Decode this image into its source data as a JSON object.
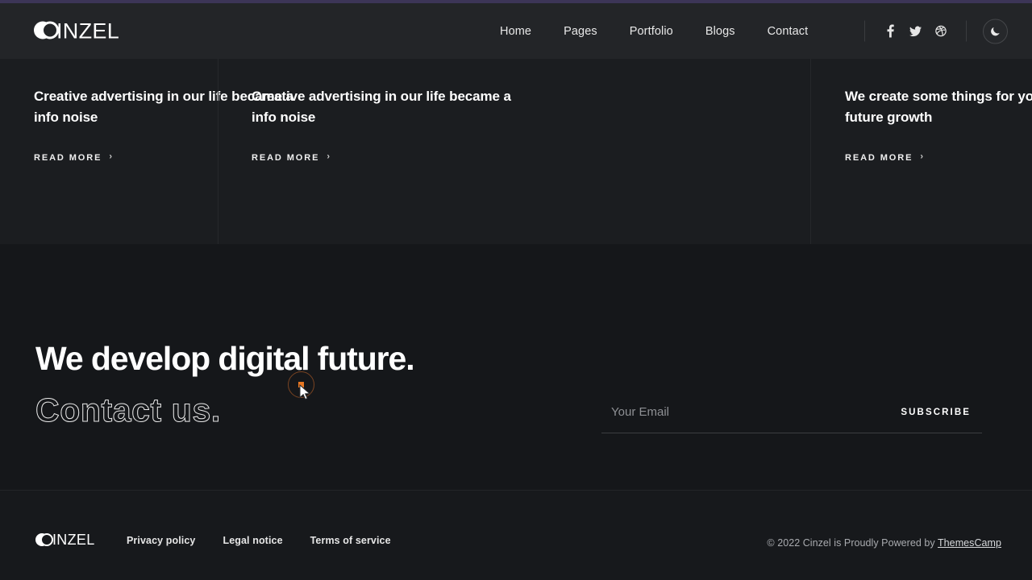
{
  "header": {
    "logo": {
      "mark": "double-moon-logo-icon",
      "word": "INZEL"
    },
    "nav": [
      {
        "label": "Home"
      },
      {
        "label": "Pages"
      },
      {
        "label": "Portfolio"
      },
      {
        "label": "Blogs"
      },
      {
        "label": "Contact"
      }
    ],
    "social": [
      {
        "name": "facebook-icon",
        "label": "Facebook"
      },
      {
        "name": "twitter-icon",
        "label": "Twitter"
      },
      {
        "name": "dribbble-icon",
        "label": "Dribbble"
      }
    ],
    "theme_toggle": {
      "name": "moon-icon",
      "label": "Dark mode"
    }
  },
  "cards": [
    {
      "title": "Creative advertising in our life became a info noise",
      "read_more": "READ MORE",
      "chevron": "›"
    },
    {
      "title": "Creative advertising in our life became a info noise",
      "read_more": "READ MORE",
      "chevron": "›"
    },
    {
      "title": "We create some things for your success in future growth",
      "read_more": "READ MORE",
      "chevron": "›"
    }
  ],
  "cta": {
    "heading": "We develop digital future.",
    "subheading": "Contact us.",
    "subscribe": {
      "placeholder": "Your Email",
      "value": "",
      "button_label": "SUBSCRIBE"
    }
  },
  "footer": {
    "logo": {
      "mark": "double-moon-logo-icon",
      "word": "INZEL"
    },
    "links": [
      {
        "label": "Privacy policy"
      },
      {
        "label": "Legal notice"
      },
      {
        "label": "Terms of service"
      }
    ],
    "copyright_prefix": "© 2022 Cinzel is Proudly Powered by ",
    "copyright_link": "ThemesCamp"
  },
  "colors": {
    "page_bg": "#15171a",
    "header_bg": "#232528",
    "cards_bg": "#1b1d20",
    "footer_bg": "#17191c",
    "top_accent": "#3c3557",
    "cursor_accent": "#e87722",
    "text_primary": "#ffffff",
    "text_muted": "#a9abaf"
  }
}
